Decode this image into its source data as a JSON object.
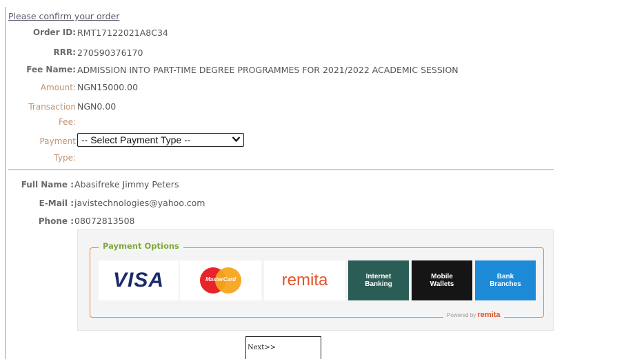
{
  "header": {
    "title": "Please confirm your order"
  },
  "order": {
    "order_id_label": "Order ID:",
    "order_id": "RMT17122021A8C34",
    "rrr_label": "RRR:",
    "rrr": "270590376170",
    "fee_name_label": "Fee Name:",
    "fee_name": "ADMISSION INTO PART-TIME DEGREE PROGRAMMES FOR 2021/2022 ACADEMIC SESSION",
    "amount_label": "Amount:",
    "amount": "NGN15000.00",
    "transaction_fee_label_1": "Transaction",
    "transaction_fee_label_2": "Fee:",
    "transaction_fee": "NGN0.00",
    "payment_type_label_1": "Payment",
    "payment_type_label_2": "Type:",
    "payment_type_selected": "-- Select Payment Type --"
  },
  "payer": {
    "full_name_label": "Full Name :",
    "full_name": "Abasifreke Jimmy Peters",
    "email_label": "E-Mail :",
    "email": "javistechnologies@yahoo.com",
    "phone_label": "Phone :",
    "phone": "08072813508"
  },
  "payment_options": {
    "legend": "Payment Options",
    "tiles": {
      "visa": "VISA",
      "mastercard": "MasterCard",
      "remita": "remita",
      "internet_banking_1": "Internet",
      "internet_banking_2": "Banking",
      "mobile_wallets_1": "Mobile",
      "mobile_wallets_2": "Wallets",
      "bank_branches_1": "Bank",
      "bank_branches_2": "Branches"
    },
    "powered_by": "Powered by",
    "powered_brand": "remita",
    "colors": {
      "border": "#e8893a",
      "legend": "#7ea93b",
      "remita": "#e2542a",
      "internet_banking": "#2a5d56",
      "mobile_wallets": "#151515",
      "bank_branches": "#1d8ad8"
    }
  },
  "actions": {
    "next_label": "Next>>"
  }
}
